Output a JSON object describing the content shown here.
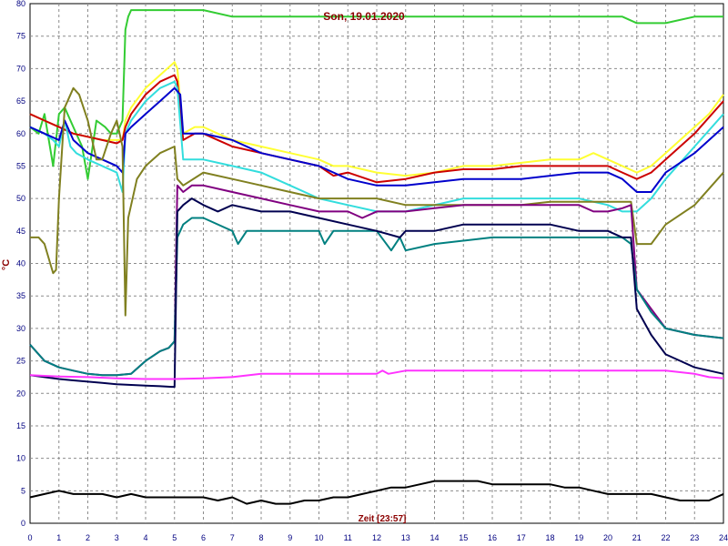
{
  "chart_data": {
    "type": "line",
    "title": "Son, 19.01.2020",
    "xlabel": "Zeit [23:57]",
    "ylabel": "°C",
    "xlim": [
      0,
      24
    ],
    "ylim": [
      0,
      80
    ],
    "x_ticks": [
      "0",
      "1",
      "2",
      "3",
      "4",
      "5",
      "6",
      "7",
      "8",
      "9",
      "10",
      "11",
      "12",
      "13",
      "14",
      "15",
      "16",
      "17",
      "18",
      "19",
      "20",
      "21",
      "22",
      "23",
      "24"
    ],
    "y_ticks": [
      "0",
      "5",
      "10",
      "15",
      "20",
      "25",
      "30",
      "35",
      "40",
      "45",
      "50",
      "55",
      "60",
      "65",
      "70",
      "75",
      "80"
    ],
    "grid": true,
    "legend": "none",
    "series": [
      {
        "color": "#33cc33",
        "x": [
          0,
          0.3,
          0.5,
          0.8,
          1.0,
          1.2,
          1.5,
          1.8,
          2.0,
          2.3,
          2.6,
          2.8,
          3.0,
          3.2,
          3.3,
          3.4,
          3.5,
          3.6,
          3.8,
          4.0,
          4.5,
          5.0,
          5.5,
          6.0,
          7.0,
          8.0,
          9.0,
          10.0,
          11.0,
          12.0,
          13.0,
          14.0,
          15.0,
          16.0,
          17.0,
          18.0,
          19.0,
          20.0,
          20.5,
          21.0,
          21.5,
          22.0,
          23.0,
          24.0
        ],
        "y": [
          61,
          60,
          63,
          55,
          63,
          64,
          61,
          58,
          53,
          62,
          61,
          60,
          60,
          62,
          76,
          78,
          79,
          79,
          79,
          79,
          79,
          79,
          79,
          79,
          78,
          78,
          78,
          78,
          78,
          78,
          78,
          78,
          78,
          78,
          78,
          78,
          78,
          78,
          78,
          77,
          77,
          77,
          78,
          78
        ]
      },
      {
        "color": "#ffff33",
        "x": [
          0,
          0.5,
          1.0,
          1.5,
          2.0,
          2.5,
          3.0,
          3.2,
          3.3,
          3.5,
          4.0,
          4.5,
          5.0,
          5.1,
          5.3,
          5.7,
          6.0,
          6.5,
          7.0,
          8.0,
          9.0,
          10.0,
          10.5,
          11.0,
          12.0,
          13.0,
          14.0,
          15.0,
          16.0,
          17.0,
          18.0,
          19.0,
          19.5,
          20.0,
          20.5,
          21.0,
          21.5,
          22.0,
          22.5,
          23.0,
          23.5,
          24.0
        ],
        "y": [
          63,
          62,
          61,
          60,
          59.5,
          59,
          59,
          59,
          62,
          64,
          67,
          69,
          71,
          70,
          60,
          61,
          61,
          60,
          59,
          58,
          57,
          56,
          55,
          55,
          54,
          53.5,
          54,
          55,
          55,
          55.5,
          56,
          56,
          57,
          56,
          55,
          54,
          55,
          57,
          59,
          61,
          63,
          66
        ]
      },
      {
        "color": "#cc0000",
        "x": [
          0,
          0.5,
          1.0,
          1.5,
          2.0,
          2.5,
          3.0,
          3.2,
          3.3,
          3.5,
          4.0,
          4.5,
          5.0,
          5.1,
          5.3,
          5.7,
          6.0,
          6.5,
          7.0,
          8.0,
          9.0,
          10.0,
          10.5,
          11.0,
          12.0,
          13.0,
          14.0,
          15.0,
          16.0,
          17.0,
          18.0,
          19.0,
          20.0,
          20.5,
          21.0,
          21.5,
          22.0,
          23.0,
          24.0
        ],
        "y": [
          63,
          62,
          61,
          60,
          59.5,
          59,
          58.5,
          59,
          61,
          63,
          66,
          68,
          69,
          68,
          59,
          60,
          60,
          59,
          58,
          57,
          56,
          55,
          53.5,
          54,
          52.5,
          53,
          54,
          54.5,
          54.5,
          55,
          55,
          55,
          55,
          54,
          53,
          54,
          56,
          60,
          65
        ]
      },
      {
        "color": "#33dddd",
        "x": [
          0,
          0.5,
          0.8,
          1.0,
          1.2,
          1.4,
          1.6,
          2.0,
          2.5,
          3.0,
          3.2,
          3.3,
          3.4,
          3.5,
          4.0,
          4.5,
          5.0,
          5.1,
          5.3,
          6.0,
          7.0,
          8.0,
          9.0,
          10.0,
          11.0,
          12.0,
          12.5,
          13.0,
          14.0,
          15.0,
          16.0,
          17.0,
          18.0,
          19.0,
          20.0,
          20.5,
          21.0,
          21.5,
          22.0,
          23.0,
          24.0
        ],
        "y": [
          61,
          60,
          59,
          58,
          62,
          58,
          57,
          56,
          55,
          54,
          51,
          60,
          61,
          62,
          65,
          67,
          68,
          67,
          56,
          56,
          55,
          54,
          52,
          50,
          49,
          48,
          48,
          48,
          49,
          50,
          50,
          50,
          50,
          50,
          49,
          48,
          48,
          50,
          53,
          58,
          63
        ]
      },
      {
        "color": "#0000cc",
        "x": [
          0,
          0.5,
          1.0,
          1.2,
          1.5,
          2.0,
          2.5,
          3.0,
          3.2,
          3.3,
          3.5,
          4.0,
          4.5,
          5.0,
          5.2,
          5.3,
          6.0,
          7.0,
          8.0,
          9.0,
          10.0,
          11.0,
          12.0,
          13.0,
          14.0,
          15.0,
          16.0,
          17.0,
          18.0,
          19.0,
          20.0,
          20.5,
          21.0,
          21.5,
          22.0,
          23.0,
          24.0
        ],
        "y": [
          61,
          60,
          59,
          62,
          59,
          57,
          56,
          55,
          54,
          60,
          61,
          63,
          65,
          67,
          66,
          60,
          60,
          59,
          57,
          56,
          55,
          53,
          52,
          52,
          52.5,
          53,
          53,
          53,
          53.5,
          54,
          54,
          53,
          51,
          51,
          54,
          57,
          61
        ]
      },
      {
        "color": "#808020",
        "x": [
          0,
          0.3,
          0.5,
          0.7,
          0.8,
          0.9,
          1.0,
          1.2,
          1.5,
          1.7,
          2.0,
          2.3,
          2.5,
          2.8,
          3.0,
          3.2,
          3.3,
          3.4,
          3.5,
          3.7,
          4.0,
          4.5,
          5.0,
          5.1,
          5.3,
          6.0,
          7.0,
          8.0,
          9.0,
          10.0,
          11.0,
          12.0,
          13.0,
          14.0,
          15.0,
          16.0,
          17.0,
          18.0,
          19.0,
          20.0,
          20.5,
          20.8,
          21.0,
          21.5,
          22.0,
          23.0,
          24.0
        ],
        "y": [
          44,
          44,
          43,
          40,
          38.5,
          39,
          50,
          64,
          67,
          66,
          62,
          56,
          56,
          60,
          62,
          58,
          32,
          47,
          49,
          53,
          55,
          57,
          58,
          53,
          52,
          54,
          53,
          52,
          51,
          50,
          50,
          50,
          49,
          49,
          49,
          49,
          49,
          49.5,
          49.5,
          49.5,
          49.5,
          49.5,
          43,
          43,
          46,
          49,
          54
        ]
      },
      {
        "color": "#800080",
        "x": [
          0,
          0.5,
          1.0,
          1.5,
          2.0,
          2.5,
          3.0,
          3.5,
          4.0,
          4.5,
          4.8,
          5.0,
          5.1,
          5.3,
          5.6,
          6.0,
          7.0,
          8.0,
          9.0,
          10.0,
          11.0,
          11.5,
          12.0,
          13.0,
          14.0,
          15.0,
          16.0,
          17.0,
          18.0,
          19.0,
          19.5,
          20.0,
          20.5,
          20.8,
          21.0,
          21.5,
          22.0,
          23.0,
          24.0
        ],
        "y": [
          27.5,
          25,
          24,
          23.5,
          23,
          22.8,
          22.8,
          23,
          25,
          26.5,
          27,
          28,
          52,
          51,
          52,
          52,
          51,
          50,
          49,
          48,
          48,
          47,
          48,
          48,
          48.5,
          49,
          49,
          49,
          49,
          49,
          48,
          48,
          48.5,
          49,
          36,
          33,
          30,
          29,
          28.5
        ]
      },
      {
        "color": "#008080",
        "x": [
          0,
          0.5,
          1.0,
          1.5,
          2.0,
          2.5,
          3.0,
          3.5,
          4.0,
          4.5,
          4.8,
          5.0,
          5.1,
          5.3,
          5.6,
          6.0,
          7.0,
          7.2,
          7.5,
          8.0,
          9.0,
          10.0,
          10.2,
          10.5,
          11.0,
          12.0,
          12.5,
          12.8,
          13.0,
          14.0,
          15.0,
          16.0,
          17.0,
          18.0,
          19.0,
          20.0,
          20.5,
          20.8,
          21.0,
          21.5,
          22.0,
          23.0,
          24.0
        ],
        "y": [
          27.5,
          25,
          24,
          23.5,
          23,
          22.8,
          22.8,
          23,
          25,
          26.5,
          27,
          28,
          44,
          46,
          47,
          47,
          45,
          43,
          45,
          45,
          45,
          45,
          43,
          45,
          45,
          45,
          42,
          44,
          42,
          43,
          43.5,
          44,
          44,
          44,
          44,
          44,
          44,
          43,
          36,
          32.5,
          30,
          29,
          28.5
        ]
      },
      {
        "color": "#000050",
        "x": [
          0,
          0.5,
          1.0,
          1.5,
          2.0,
          2.5,
          3.0,
          3.5,
          4.0,
          4.5,
          4.9,
          5.0,
          5.1,
          5.3,
          5.6,
          6.0,
          6.5,
          7.0,
          8.0,
          9.0,
          10.0,
          11.0,
          12.0,
          12.8,
          13.0,
          14.0,
          15.0,
          16.0,
          17.0,
          18.0,
          19.0,
          20.0,
          20.5,
          20.8,
          21.0,
          21.5,
          22.0,
          23.0,
          24.0
        ],
        "y": [
          22.8,
          22.5,
          22.2,
          22,
          21.8,
          21.6,
          21.4,
          21.3,
          21.2,
          21.1,
          21,
          21,
          48,
          49,
          50,
          49,
          48,
          49,
          48,
          48,
          47,
          46,
          45,
          44,
          45,
          45,
          46,
          46,
          46,
          46,
          45,
          45,
          44,
          44,
          33,
          29,
          26,
          24,
          23
        ]
      },
      {
        "color": "#ff33ff",
        "x": [
          0,
          1,
          2,
          3,
          4,
          5,
          6,
          7,
          8,
          9,
          10,
          11,
          12,
          12.2,
          12.4,
          13,
          14,
          15,
          16,
          17,
          18,
          19,
          20,
          21,
          22,
          23,
          23.5,
          24
        ],
        "y": [
          22.8,
          22.6,
          22.5,
          22.3,
          22.2,
          22.2,
          22.3,
          22.5,
          23,
          23,
          23,
          23,
          23,
          23.5,
          23,
          23.5,
          23.5,
          23.5,
          23.5,
          23.5,
          23.5,
          23.5,
          23.5,
          23.5,
          23.5,
          23,
          22.5,
          22.3
        ]
      },
      {
        "color": "#000000",
        "x": [
          0,
          0.5,
          1.0,
          1.5,
          2.0,
          2.5,
          3.0,
          3.5,
          4.0,
          4.5,
          5.0,
          5.5,
          6.0,
          6.5,
          7.0,
          7.5,
          8.0,
          8.5,
          9.0,
          9.5,
          10.0,
          10.5,
          11.0,
          11.5,
          12.0,
          12.5,
          13.0,
          13.5,
          14.0,
          14.5,
          15.0,
          15.5,
          16.0,
          16.5,
          17.0,
          17.5,
          18.0,
          18.5,
          19.0,
          19.5,
          20.0,
          20.5,
          21.0,
          21.5,
          22.0,
          22.5,
          23.0,
          23.5,
          24.0
        ],
        "y": [
          4,
          4.5,
          5,
          4.5,
          4.5,
          4.5,
          4,
          4.5,
          4,
          4,
          4,
          4,
          4,
          3.5,
          4,
          3,
          3.5,
          3,
          3,
          3.5,
          3.5,
          4,
          4,
          4.5,
          5,
          5.5,
          5.5,
          6,
          6.5,
          6.5,
          6.5,
          6.5,
          6,
          6,
          6,
          6,
          6,
          5.5,
          5.5,
          5,
          4.5,
          4.5,
          4.5,
          4.5,
          4,
          3.5,
          3.5,
          3.5,
          4.5
        ]
      }
    ]
  }
}
